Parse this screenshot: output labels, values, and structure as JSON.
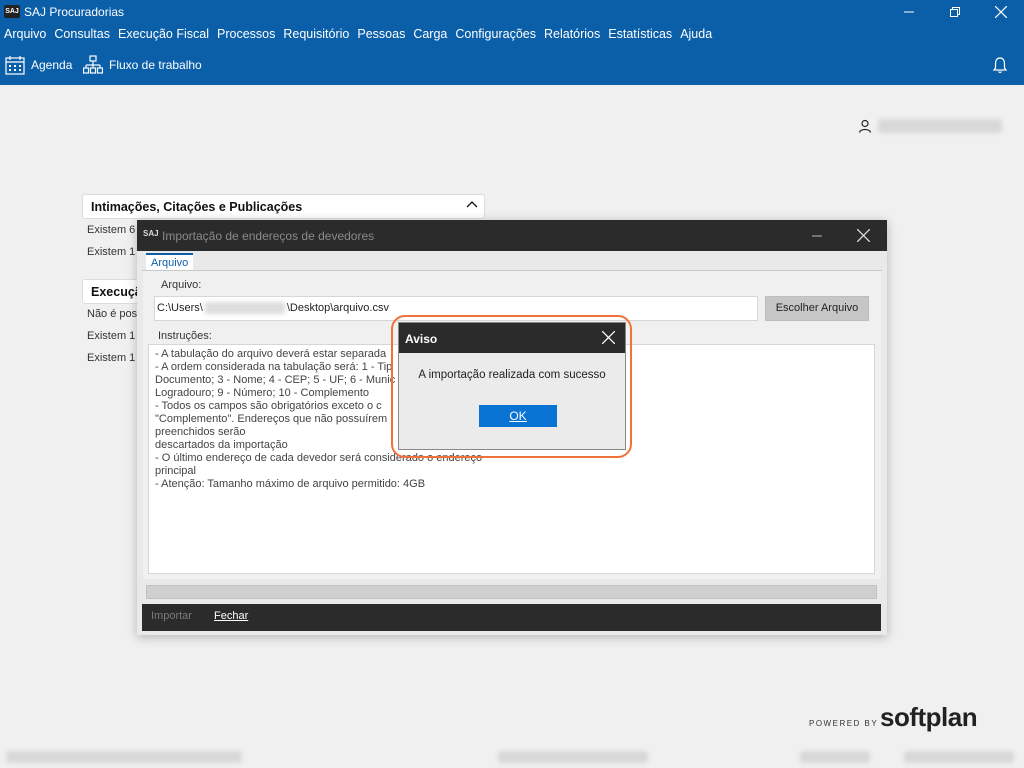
{
  "window": {
    "logo_text": "SAJ",
    "title": "SAJ Procuradorias"
  },
  "menu": [
    "Arquivo",
    "Consultas",
    "Execução Fiscal",
    "Processos",
    "Requisitório",
    "Pessoas",
    "Carga",
    "Configurações",
    "Relatórios",
    "Estatísticas",
    "Ajuda"
  ],
  "toolbar": {
    "agenda_label": "Agenda",
    "workflow_label": "Fluxo de trabalho"
  },
  "background": {
    "panel1_title": "Intimações, Citações e Publicações",
    "panel2_title": "Execuçã",
    "lines": [
      "Existem  6",
      "Existem  1",
      "Não é pos",
      "Existem  1",
      "Existem  1"
    ]
  },
  "import_dialog": {
    "logo_text": "SAJ",
    "title": "Importação de endereços de devedores",
    "tab_label": "Arquivo",
    "file_label": "Arquivo:",
    "file_path_start": "C:\\Users\\",
    "file_path_end": "\\Desktop\\arquivo.csv",
    "choose_button": "Escolher Arquivo",
    "instructions_label": "Instruções:",
    "instructions": [
      "- A tabulação do arquivo deverá estar separada",
      "- A ordem considerada na tabulação será: 1 - Tip",
      "Documento; 3 - Nome; 4 - CEP; 5 - UF; 6 - Munic",
      "Logradouro; 9 - Número; 10 - Complemento",
      "- Todos os campos são obrigatórios exceto o c",
      "\"Complemento\". Endereços que não possuírem",
      "preenchidos serão",
      "descartados da importação",
      "- O último endereço de cada devedor será considerado o endereço",
      "principal",
      "- Atenção: Tamanho máximo de arquivo permitido: 4GB"
    ],
    "import_button": "Importar",
    "close_button": "Fechar"
  },
  "alert": {
    "title": "Aviso",
    "message": "A importação realizada com sucesso",
    "ok_button": "OK"
  },
  "footer": {
    "powered_by": "POWERED BY",
    "brand": "softplan"
  },
  "colors": {
    "accent": "#0a5fa8",
    "dark": "#2b2b2b",
    "highlight": "#f07238",
    "ok_button": "#0a74d4"
  }
}
